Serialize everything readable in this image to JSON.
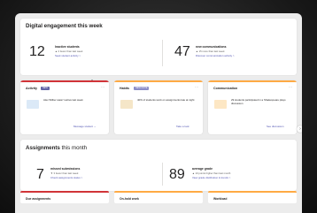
{
  "engagement": {
    "title": "Digital engagement this week",
    "inactive": {
      "number": "12",
      "title": "Inactive students",
      "sub": "▲ 2 fewer than last week",
      "link": "Seek student activity  >"
    },
    "communications": {
      "number": "47",
      "title": "new communications",
      "sub": "▲ 15 more than last week",
      "link": "Discover communication activity  >"
    }
  },
  "insights": [
    {
      "title": "Activity",
      "badge": "NEW",
      "body": "Alex Wilber wasn't active last week",
      "action": "Message student  ⌄",
      "accent": "#d13438",
      "badge_color": "#6264a7"
    },
    {
      "title": "Habits",
      "badge": "NEW NOTE",
      "body": "40% of students work on assignments late at night",
      "action": "Take a look",
      "accent": "#ffaa44",
      "badge_color": "#8b8cc7"
    },
    {
      "title": "Communication",
      "badge": "",
      "body": "29 students participated in a Shakespeare plays discussion",
      "action": "See discussion",
      "accent": "#ffaa44",
      "badge_color": ""
    }
  ],
  "assignments": {
    "title_bold": "Assignments",
    "title_rest": " this month",
    "missed": {
      "number": "7",
      "title": "missed submissions",
      "sub": "▼ 3 fewer than last week",
      "link": "Check assignments status  >"
    },
    "grade": {
      "number": "89",
      "title": "average grade",
      "sub": "▲ 10 points higher than last month",
      "link": "View grade distribution & trends  >"
    }
  },
  "bottom_tabs": [
    "Due assignments",
    "On-hold work",
    "Workload"
  ],
  "icons": {
    "cursor": "hand-pointer-icon",
    "next": "chevron-right-icon"
  }
}
